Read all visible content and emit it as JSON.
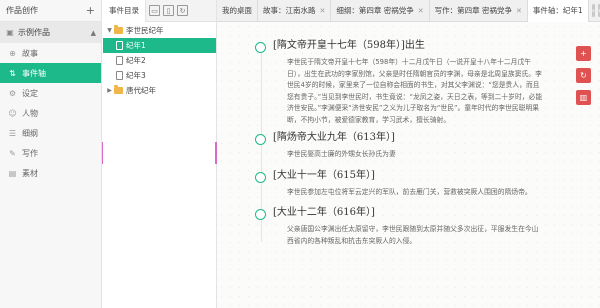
{
  "sidebar": {
    "title": "作品创作",
    "add_icon": "plus-icon",
    "work": {
      "label": "示例作品",
      "icon": "book-icon"
    },
    "items": [
      {
        "label": "故事",
        "icon": "globe-icon"
      },
      {
        "label": "事件轴",
        "icon": "timeline-icon"
      },
      {
        "label": "设定",
        "icon": "gear-icon"
      },
      {
        "label": "人物",
        "icon": "person-icon"
      },
      {
        "label": "细纲",
        "icon": "outline-icon"
      },
      {
        "label": "写作",
        "icon": "pen-icon"
      },
      {
        "label": "素材",
        "icon": "archive-icon"
      }
    ]
  },
  "directory": {
    "tab_label": "事件目录",
    "tools": [
      "folder-add-icon",
      "file-add-icon",
      "sync-icon"
    ],
    "tree": [
      {
        "label": "李世民纪年",
        "type": "folder",
        "expanded": true
      },
      {
        "label": "纪年1",
        "type": "doc",
        "selected": true
      },
      {
        "label": "纪年2",
        "type": "doc"
      },
      {
        "label": "纪年3",
        "type": "doc"
      },
      {
        "label": "唐代纪年",
        "type": "folder",
        "expanded": false
      }
    ]
  },
  "tabs": [
    {
      "label": "我的桌面",
      "closable": false
    },
    {
      "label": "故事：江南水路",
      "closable": true
    },
    {
      "label": "细纲：第四章 密祸党争",
      "closable": true
    },
    {
      "label": "写作：第四章 密祸党争",
      "closable": true
    },
    {
      "label": "事件轴：纪年1",
      "closable": true,
      "active": true
    }
  ],
  "timeline": [
    {
      "title": "[隋文帝开皇十七年（598年）]出生",
      "text": "李世民于隋文帝开皇十七年（598年）十二月戊午日（一说开皇十八年十二月戊午日），出生在武功的李家别馆，父亲是时任隋朝官员的李渊，母亲是北周皇族窦氏。李世民4岁的时候，家里来了一位自称会相面的书生，对其父李渊说：“您是贵人，而且您有贵子。”当见到李世民时，书生竟说：“龙凤之姿，天日之表，等到二十岁时，必能济世安民。”李渊便采“济世安民”之义为儿子取名为“世民”。童年时代的李世民聪明果断，不拘小节，被爱德家教育，学习武术，擅长骑射。"
    },
    {
      "title": "[隋炀帝大业九年（613年）]",
      "text": "李世民娶高士廉的外甥女长孙氏为妻"
    },
    {
      "title": "[大业十一年（615年）]",
      "text": "李世民参加左屯位将军云定兴的军队，前去雁门关，营救被突厥人围困的隋炀帝。"
    },
    {
      "title": "[大业十二年（616年）]",
      "text": "父亲唐国公李渊出任太原留守，李世民跟随到太原并随父多次出征，平服发生在今山西省内的各种叛乱和抗击东突厥人的入侵。"
    }
  ],
  "side_actions": [
    "add-icon",
    "refresh-icon",
    "delete-icon"
  ],
  "colors": {
    "accent": "#1db98a",
    "danger": "#e05252",
    "folder": "#f0b648"
  }
}
